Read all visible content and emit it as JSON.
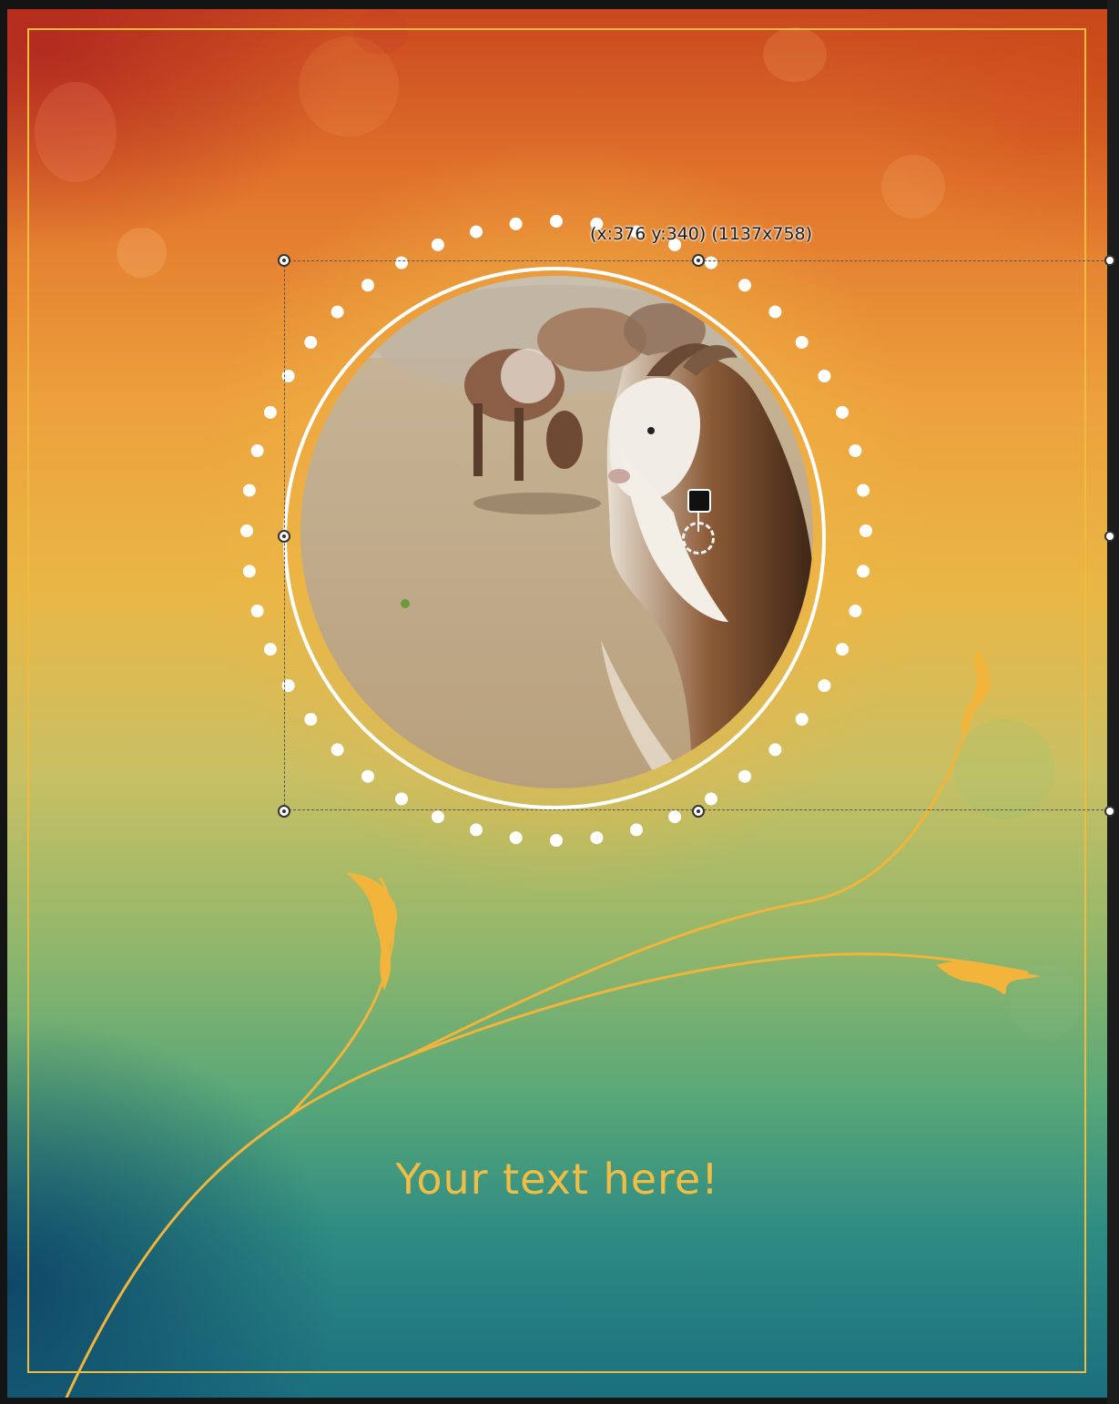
{
  "canvas": {
    "banner_text": "Your text here!",
    "selection_readout": "(x:376 y:340) (1137x758)"
  },
  "photo": {
    "subject": "goat"
  },
  "colors": {
    "accent_gold": "#f0bb3f",
    "ring_white": "#ffffff",
    "gradient_top": "#c9481f",
    "gradient_mid": "#e9b746",
    "gradient_bottom": "#1b6f7f"
  },
  "icons": {
    "rotate_handle": "rotate-handle-icon",
    "anchor_point": "anchor-point-icon",
    "resize_handle": "resize-handle-icon"
  }
}
